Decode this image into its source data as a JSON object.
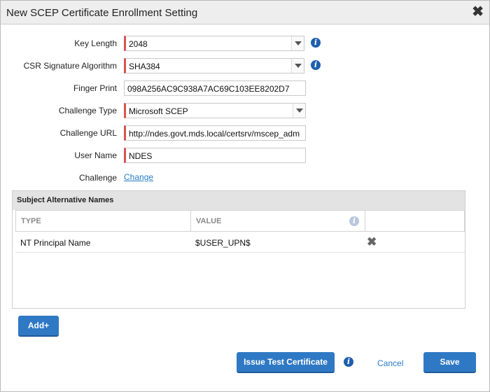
{
  "dialog": {
    "title": "New SCEP Certificate Enrollment Setting"
  },
  "form": {
    "key_length": {
      "label": "Key Length",
      "value": "2048"
    },
    "csr_alg": {
      "label": "CSR Signature Algorithm",
      "value": "SHA384"
    },
    "fingerprint": {
      "label": "Finger Print",
      "value": "098A256AC9C938A7AC69C103EE8202D7"
    },
    "challenge_type": {
      "label": "Challenge Type",
      "value": "Microsoft SCEP"
    },
    "challenge_url": {
      "label": "Challenge URL",
      "value": "http://ndes.govt.mds.local/certsrv/mscep_adm"
    },
    "user_name": {
      "label": "User Name",
      "value": "NDES"
    },
    "challenge": {
      "label": "Challenge",
      "link": "Change"
    }
  },
  "san": {
    "title": "Subject Alternative Names",
    "columns": {
      "type": "TYPE",
      "value": "VALUE"
    },
    "rows": [
      {
        "type": "NT Principal Name",
        "value": "$USER_UPN$"
      }
    ]
  },
  "buttons": {
    "add": "Add+",
    "issue_test": "Issue Test Certificate",
    "cancel": "Cancel",
    "save": "Save"
  },
  "icons": {
    "info": "info-icon",
    "close": "close-icon",
    "delete": "delete-icon",
    "caret": "chevron-down-icon"
  },
  "colors": {
    "accent": "#2f79c4",
    "required": "#d9534f",
    "info": "#1f5fae",
    "link": "#2a7cc7"
  }
}
